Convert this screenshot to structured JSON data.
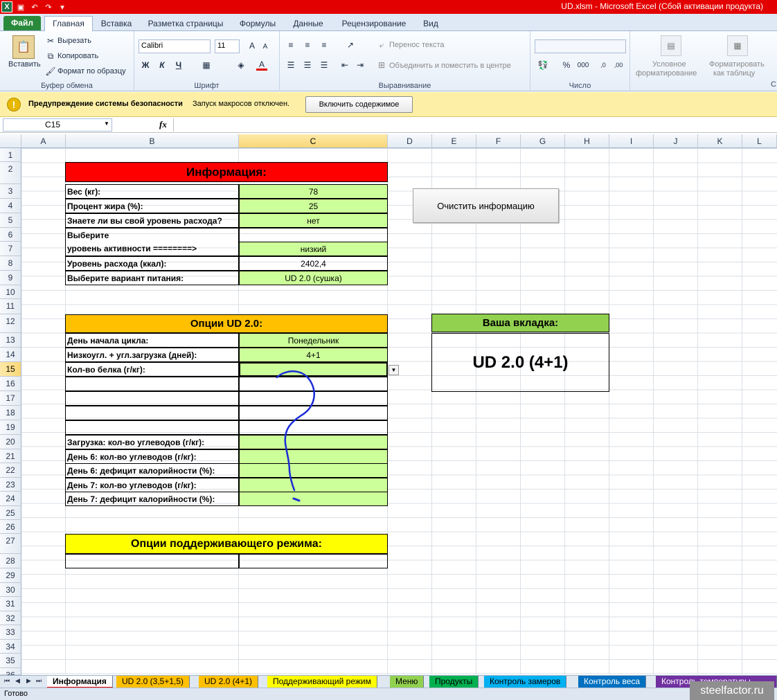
{
  "window": {
    "title": "UD.xlsm  -  Microsoft Excel (Сбой активации продукта)",
    "app_icon": "X"
  },
  "ribbon_tabs": [
    "Файл",
    "Главная",
    "Вставка",
    "Разметка страницы",
    "Формулы",
    "Данные",
    "Рецензирование",
    "Вид"
  ],
  "ribbon": {
    "clipboard": {
      "paste": "Вставить",
      "cut": "Вырезать",
      "copy": "Копировать",
      "format_painter": "Формат по образцу",
      "label": "Буфер обмена"
    },
    "font": {
      "name": "Calibri",
      "size": "11",
      "label": "Шрифт",
      "bold": "Ж",
      "italic": "К",
      "underline": "Ч"
    },
    "alignment": {
      "wrap": "Перенос текста",
      "merge": "Объединить и поместить в центре",
      "label": "Выравнивание"
    },
    "number": {
      "label": "Число",
      "percent": "%",
      "thousands": "000"
    },
    "styles": {
      "conditional_1": "Условное",
      "conditional_2": "форматирование",
      "as_table_1": "Форматировать",
      "as_table_2": "как таблицу",
      "cut_label": "С"
    }
  },
  "security_bar": {
    "title": "Предупреждение системы безопасности",
    "message": "Запуск макросов отключен.",
    "button": "Включить содержимое"
  },
  "formula_bar": {
    "cell_ref": "C15",
    "fx": "fx",
    "value": ""
  },
  "columns": [
    "A",
    "B",
    "C",
    "D",
    "E",
    "F",
    "G",
    "H",
    "I",
    "J",
    "K",
    "L"
  ],
  "rows": [
    "1",
    "2",
    "3",
    "4",
    "5",
    "6",
    "7",
    "8",
    "9",
    "10",
    "11",
    "12",
    "13",
    "14",
    "15",
    "16",
    "17",
    "18",
    "19",
    "20",
    "21",
    "22",
    "23",
    "24",
    "25",
    "26",
    "27",
    "28",
    "29",
    "30",
    "31",
    "32",
    "33",
    "34",
    "35",
    "36"
  ],
  "info_table": {
    "header": "Информация:",
    "weight_label": "Вес (кг):",
    "weight": "78",
    "fat_label": "Процент жира (%):",
    "fat": "25",
    "know_label": "Знаете ли вы свой уровень расхода?",
    "know": "нет",
    "activity_label_1": "Выберите",
    "activity_label_2": "уровень активности ========>",
    "activity": "низкий",
    "expense_label": "Уровень расхода (ккал):",
    "expense": "2402,4",
    "plan_label": "Выберите вариант питания:",
    "plan": "UD 2.0 (сушка)"
  },
  "clear_button": "Очистить информацию",
  "ud_table": {
    "header": "Опции UD 2.0:",
    "start_label": "День начала цикла:",
    "start": "Понедельник",
    "load_label": "Низкоугл. + угл.загрузка (дней):",
    "load": "4+1",
    "protein_label": "Кол-во белка (г/кг):",
    "carb_load_label": "Загрузка: кол-во углеводов (г/кг):",
    "day6_carb_label": "День 6: кол-во углеводов (г/кг):",
    "day6_def_label": "День 6: дефицит калорийности (%):",
    "day7_carb_label": "День 7: кол-во углеводов (г/кг):",
    "day7_def_label": "День 7: дефицит калорийности (%):"
  },
  "tab_box": {
    "header": "Ваша вкладка:",
    "value": "UD 2.0 (4+1)"
  },
  "support_table": {
    "header": "Опции поддерживающего режима:"
  },
  "sheet_tabs": [
    "Информация",
    "UD 2.0 (3,5+1,5)",
    "UD 2.0 (4+1)",
    "Поддерживающий режим",
    "Меню",
    "Продукты",
    "Контроль замеров",
    "Контроль веса",
    "Контроль температуры"
  ],
  "status": "Готово",
  "watermark": "steelfactor.ru",
  "colors": {
    "title_red": "#e30000",
    "header_red": "#ff0000",
    "header_orange": "#ffc000",
    "header_yellow": "#ffff00",
    "header_green": "#92d050",
    "cell_green": "#ccff99",
    "ink_blue": "#1a2cd6"
  }
}
